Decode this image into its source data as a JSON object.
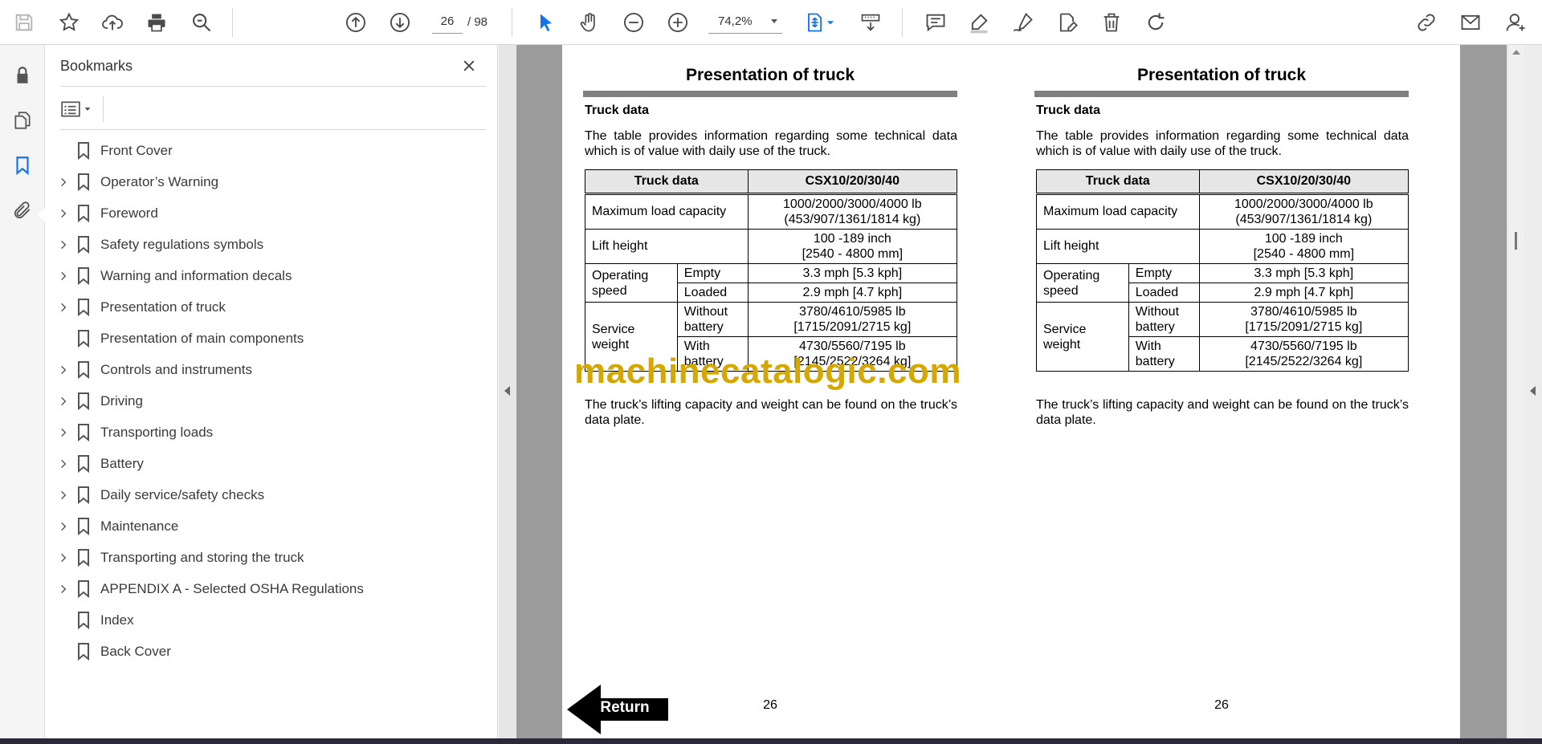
{
  "toolbar": {
    "icons": [
      "save-icon",
      "star-icon",
      "cloud-upload-icon",
      "print-icon",
      "search-icon",
      "page-up-icon",
      "page-down-icon",
      "select-arrow-icon",
      "hand-icon",
      "zoom-out-icon",
      "zoom-in-icon",
      "fit-page-icon",
      "scroll-mode-icon",
      "comment-icon",
      "highlight-icon",
      "sign-icon",
      "edit-pdf-icon",
      "delete-icon",
      "rotate-icon",
      "link-icon",
      "mail-icon",
      "account-icon"
    ],
    "page_current": "26",
    "page_total": "/ 98",
    "zoom": "74,2%"
  },
  "rail": {
    "icons": [
      "lock-icon",
      "pages-icon",
      "bookmark-icon",
      "attachment-icon"
    ],
    "active": "bookmark-icon"
  },
  "bookmarks": {
    "title": "Bookmarks",
    "items": [
      {
        "label": "Front Cover",
        "expandable": false
      },
      {
        "label": "Operator’s Warning",
        "expandable": true
      },
      {
        "label": "Foreword",
        "expandable": true
      },
      {
        "label": "Safety regulations symbols",
        "expandable": true
      },
      {
        "label": "Warning and information decals",
        "expandable": true
      },
      {
        "label": "Presentation of truck",
        "expandable": true
      },
      {
        "label": "Presentation of main components",
        "expandable": false
      },
      {
        "label": "Controls and instruments",
        "expandable": true
      },
      {
        "label": "Driving",
        "expandable": true
      },
      {
        "label": "Transporting loads",
        "expandable": true
      },
      {
        "label": "Battery",
        "expandable": true
      },
      {
        "label": "Daily service/safety checks",
        "expandable": true
      },
      {
        "label": "Maintenance",
        "expandable": true
      },
      {
        "label": "Transporting and storing the truck",
        "expandable": true
      },
      {
        "label": "APPENDIX A - Selected OSHA Regulations",
        "expandable": true
      },
      {
        "label": "Index",
        "expandable": false
      },
      {
        "label": "Back Cover",
        "expandable": false
      }
    ]
  },
  "document": {
    "title": "Presentation of truck",
    "subtitle": "Truck data",
    "intro": "The table provides information regarding some technical data which is of value with daily use of the truck.",
    "outro": "The truck’s lifting capacity and weight can be found on the truck’s data plate.",
    "page_number": "26",
    "table": {
      "header_left": "Truck data",
      "header_right": "CSX10/20/30/40",
      "max_load_label": "Maximum load capacity",
      "max_load_value_1": "1000/2000/3000/4000 lb",
      "max_load_value_2": "(453/907/1361/1814 kg)",
      "lift_height_label": "Lift height",
      "lift_height_value_1": "100 -189 inch",
      "lift_height_value_2": "[2540 - 4800 mm]",
      "op_speed_label_1": "Operating",
      "op_speed_label_2": "speed",
      "empty_label": "Empty",
      "empty_value": "3.3 mph [5.3 kph]",
      "loaded_label": "Loaded",
      "loaded_value": "2.9 mph [4.7 kph]",
      "service_weight_label_1": "Service",
      "service_weight_label_2": "weight",
      "without_battery_label_1": "Without",
      "without_battery_label_2": "battery",
      "without_battery_value_1": "3780/4610/5985 lb",
      "without_battery_value_2": "[1715/2091/2715 kg]",
      "with_battery_label_1": "With",
      "with_battery_label_2": "battery",
      "with_battery_value_1": "4730/5560/7195 lb",
      "with_battery_value_2": "[2145/2522/3264 kg]"
    },
    "watermark": "machinecatalogic.com",
    "return_label": "Return"
  }
}
